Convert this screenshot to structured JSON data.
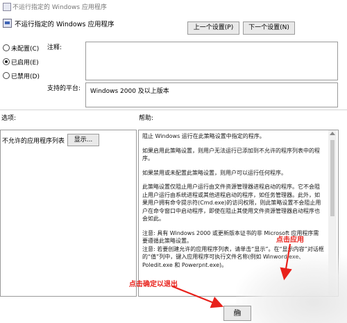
{
  "window": {
    "title": "不运行指定的 Windows 应用程序"
  },
  "header": {
    "policy_name": "不运行指定的 Windows 应用程序"
  },
  "nav": {
    "prev_label": "上一个设置(P)",
    "next_label": "下一个设置(N)"
  },
  "state": {
    "options": [
      {
        "label": "未配置(C)",
        "selected": false
      },
      {
        "label": "已启用(E)",
        "selected": true
      },
      {
        "label": "已禁用(D)",
        "selected": false
      }
    ]
  },
  "comment": {
    "label": "注释:",
    "value": ""
  },
  "platform": {
    "label": "支持的平台:",
    "value": "Windows 2000 及以上版本"
  },
  "sections": {
    "options_label": "选项:",
    "help_label": "帮助:"
  },
  "options_pane": {
    "item_label": "不允许的应用程序列表",
    "show_label": "显示..."
  },
  "help": {
    "paragraphs": [
      "阻止 Windows 运行在此策略设置中指定的程序。",
      "如果启用此策略设置，则用户无法运行已添加到不允许的程序列表中的程序。",
      "如果禁用或未配置此策略设置，则用户可以运行任何程序。",
      "此策略设置仅阻止用户运行由文件资源管理器进程启动的程序。它不会阻止用户运行由系统进程或其他进程启动的程序，如任务管理器。此外，如果用户拥有命令提示符(Cmd.exe)的访问权限，则此策略设置不会阻止用户在命令窗口中启动程序，即使在阻止其使用文件资源管理器启动程序也会如此。",
      "注意: 具有 Windows 2000 或更新版本证书的非 Microsoft 应用程序需要遵循此策略设置。\n注意: 若要创建允许的应用程序列表，请单击“显示”。在“显示内容”对话框的“值”列中，键入应用程序可执行文件名称(例如 Winword.exe、Poledit.exe 和 Powerpnt.exe)。"
    ]
  },
  "annotations": {
    "apply": "点击应用",
    "confirm": "点击确定以退出"
  },
  "footer": {
    "ok_label": "确"
  },
  "colors": {
    "annotation": "#e8211b",
    "focus": "#3b7ed8"
  }
}
